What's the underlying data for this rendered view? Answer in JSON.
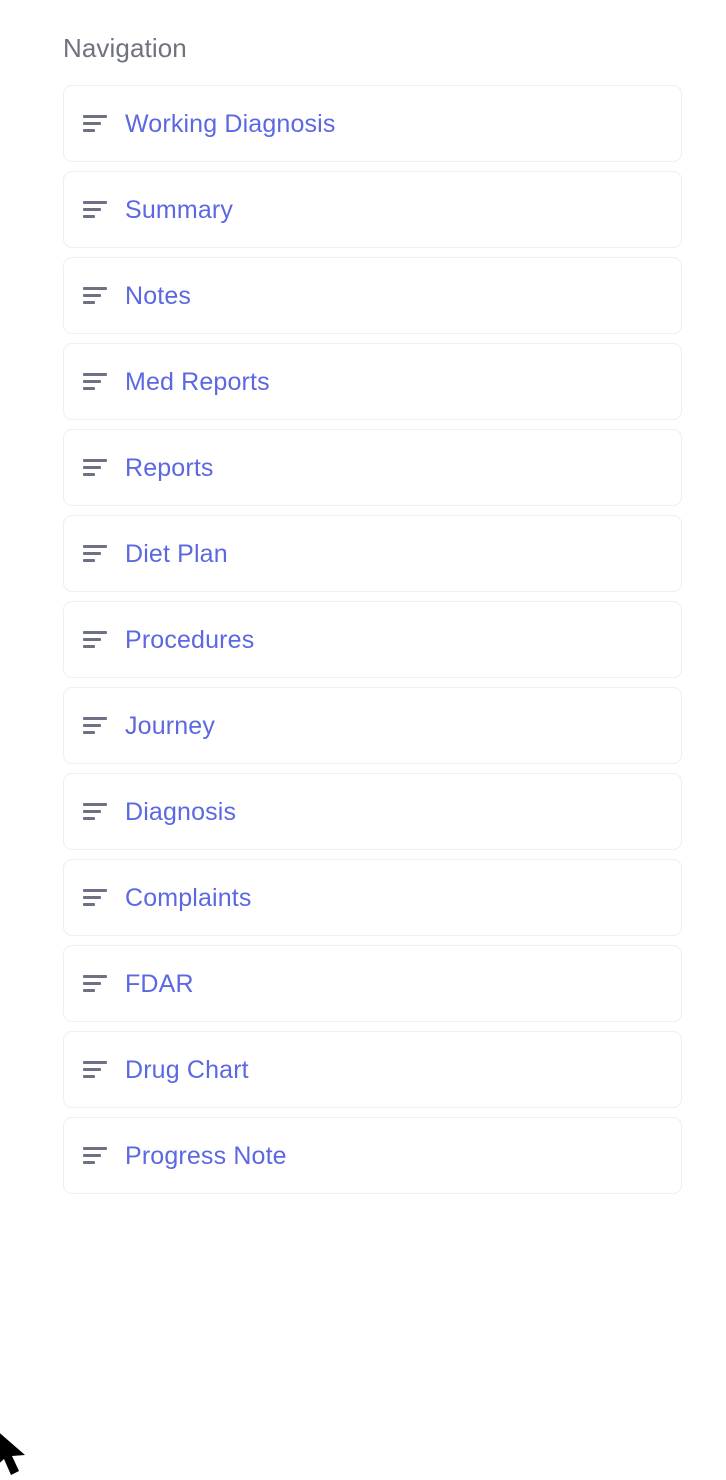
{
  "panel": {
    "title": "Navigation",
    "title_color": "#70727f",
    "background": "#ffffff"
  },
  "theme": {
    "link_color": "#5c68e2",
    "icon_color": "#6e7186",
    "card_border_color": "#eeeef4",
    "card_background": "#ffffff"
  },
  "nav": {
    "items": [
      {
        "label": "Working Diagnosis",
        "icon": "sort-lines-icon"
      },
      {
        "label": "Summary",
        "icon": "sort-lines-icon"
      },
      {
        "label": "Notes",
        "icon": "sort-lines-icon"
      },
      {
        "label": "Med Reports",
        "icon": "sort-lines-icon"
      },
      {
        "label": "Reports",
        "icon": "sort-lines-icon"
      },
      {
        "label": "Diet Plan",
        "icon": "sort-lines-icon"
      },
      {
        "label": "Procedures",
        "icon": "sort-lines-icon"
      },
      {
        "label": "Journey",
        "icon": "sort-lines-icon"
      },
      {
        "label": "Diagnosis",
        "icon": "sort-lines-icon"
      },
      {
        "label": "Complaints",
        "icon": "sort-lines-icon"
      },
      {
        "label": "FDAR",
        "icon": "sort-lines-icon"
      },
      {
        "label": "Drug Chart",
        "icon": "sort-lines-icon"
      },
      {
        "label": "Progress Note",
        "icon": "sort-lines-icon"
      }
    ]
  },
  "cursor": {
    "icon": "mouse-pointer-icon",
    "color": "#000000"
  }
}
